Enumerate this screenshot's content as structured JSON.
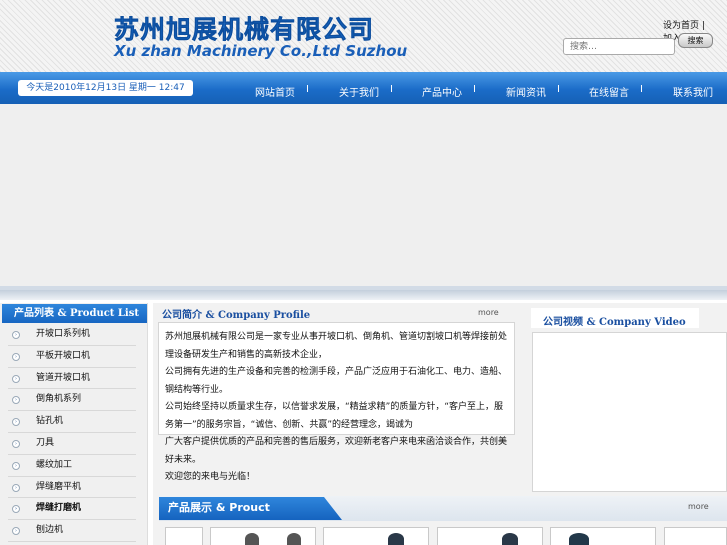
{
  "header": {
    "logo_cn": "苏州旭展机械有限公司",
    "logo_en": "Xu zhan Machinery Co.,Ltd Suzhou",
    "top_links": [
      "设为首页",
      "|",
      "加入收藏"
    ],
    "search": {
      "placeholder": "搜索…",
      "button": "搜索"
    }
  },
  "navbar": {
    "date": "今天是2010年12月13日 星期一 12:47",
    "items": [
      "网站首页",
      "关于我们",
      "产品中心",
      "新闻资讯",
      "在线留言",
      "联系我们"
    ],
    "separator": "I"
  },
  "sidebar": {
    "title": "产品列表 & Product List",
    "items": [
      "开坡口系列机",
      "平板开坡口机",
      "管道开坡口机",
      "倒角机系列",
      "钻孔机",
      "刀具",
      "螺纹加工",
      "焊缝磨平机",
      "焊缝打磨机",
      "刨边机"
    ]
  },
  "intro": {
    "title": "公司简介 & Company Profile",
    "more": "more",
    "lines": [
      "苏州旭展机械有限公司是一家专业从事开坡口机、倒角机、管道切割坡口机等焊接前处理设备研发生产和销售的高新技术企业，",
      "公司拥有先进的生产设备和完善的检测手段，产品广泛应用于石油化工、电力、造船、钢结构等行业。",
      "公司始终坚持以质量求生存，以信誉求发展，“精益求精”的质量方针，“客户至上，服务第一”的服务宗旨，“诚信、创新、共赢”的经营理念，竭诚为",
      "广大客户提供优质的产品和完善的售后服务，欢迎新老客户来电来函洽谈合作，共创美好未来。",
      "欢迎您的来电与光临！"
    ]
  },
  "video": {
    "title": "公司视频 & Company Video"
  },
  "products": {
    "title": "产品展示 & Prouct",
    "more": "more"
  }
}
